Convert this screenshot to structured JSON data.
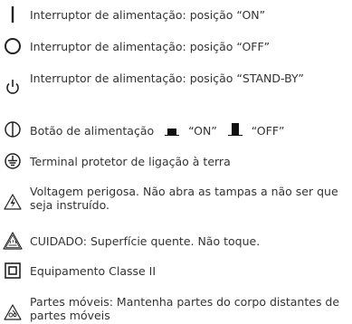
{
  "symbols": [
    {
      "icon": "power-on-line-icon",
      "text": "Interruptor de alimentação: posição “ON”"
    },
    {
      "icon": "power-off-circle-icon",
      "text": "Interruptor de alimentação: posição “OFF”"
    },
    {
      "icon": "standby-power-icon",
      "text": "Interruptor de alimentação: posição “STAND-BY”"
    },
    {
      "icon": "push-power-button-icon",
      "text_prefix": "Botão de alimentação",
      "on_label": "“ON”",
      "off_label": "“OFF”"
    },
    {
      "icon": "protective-earth-icon",
      "text": "Terminal protetor de ligação à terra"
    },
    {
      "icon": "high-voltage-warning-icon",
      "text": "Voltagem perigosa. Não abra as tampas a não ser que seja instruído."
    },
    {
      "icon": "hot-surface-warning-icon",
      "text": "CUIDADO: Superfície quente. Não toque."
    },
    {
      "icon": "class-ii-equipment-icon",
      "text": "Equipamento Classe II"
    },
    {
      "icon": "moving-parts-warning-icon",
      "text": "Partes móveis: Mantenha partes do corpo distantes de partes móveis"
    }
  ]
}
